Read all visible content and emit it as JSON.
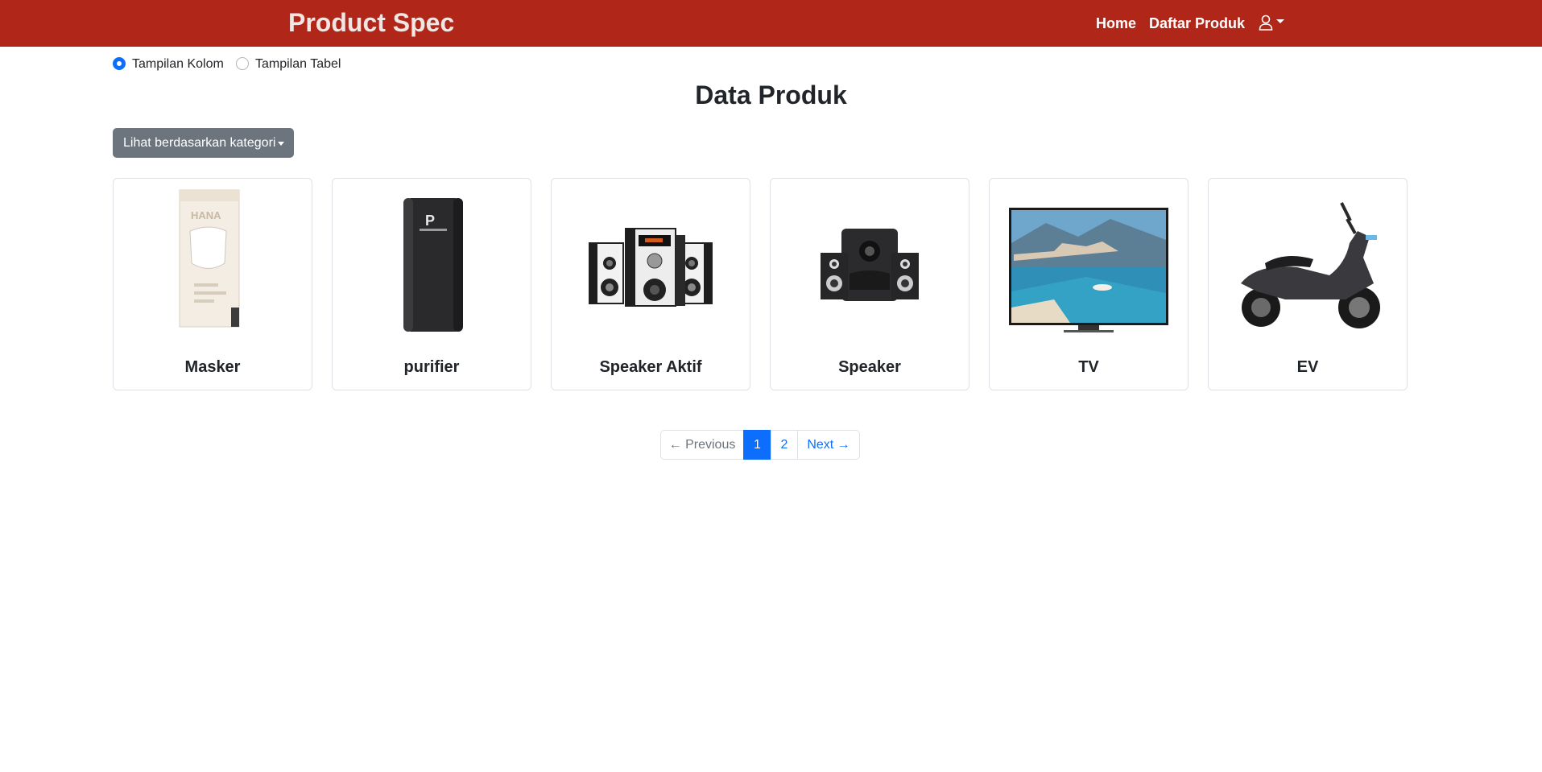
{
  "navbar": {
    "brand": "Product Spec",
    "links": [
      {
        "label": "Home"
      },
      {
        "label": "Daftar Produk"
      }
    ],
    "user_icon": "user-icon",
    "accent_color": "#b02618"
  },
  "view_options": {
    "selected": "Tampilan Kolom",
    "options": [
      {
        "label": "Tampilan Kolom",
        "checked": true
      },
      {
        "label": "Tampilan Tabel",
        "checked": false
      }
    ]
  },
  "page": {
    "title": "Data Produk"
  },
  "filter": {
    "label": "Lihat berdasarkan kategori"
  },
  "products": [
    {
      "name": "Masker",
      "icon": "mask-box-image"
    },
    {
      "name": "purifier",
      "icon": "air-purifier-image"
    },
    {
      "name": "Speaker Aktif",
      "icon": "active-speaker-image"
    },
    {
      "name": "Speaker",
      "icon": "speaker-image"
    },
    {
      "name": "TV",
      "icon": "tv-image"
    },
    {
      "name": "EV",
      "icon": "electric-scooter-image"
    }
  ],
  "pagination": {
    "previous": "← Previous",
    "pages": [
      "1",
      "2"
    ],
    "current": "1",
    "next": "Next →"
  }
}
